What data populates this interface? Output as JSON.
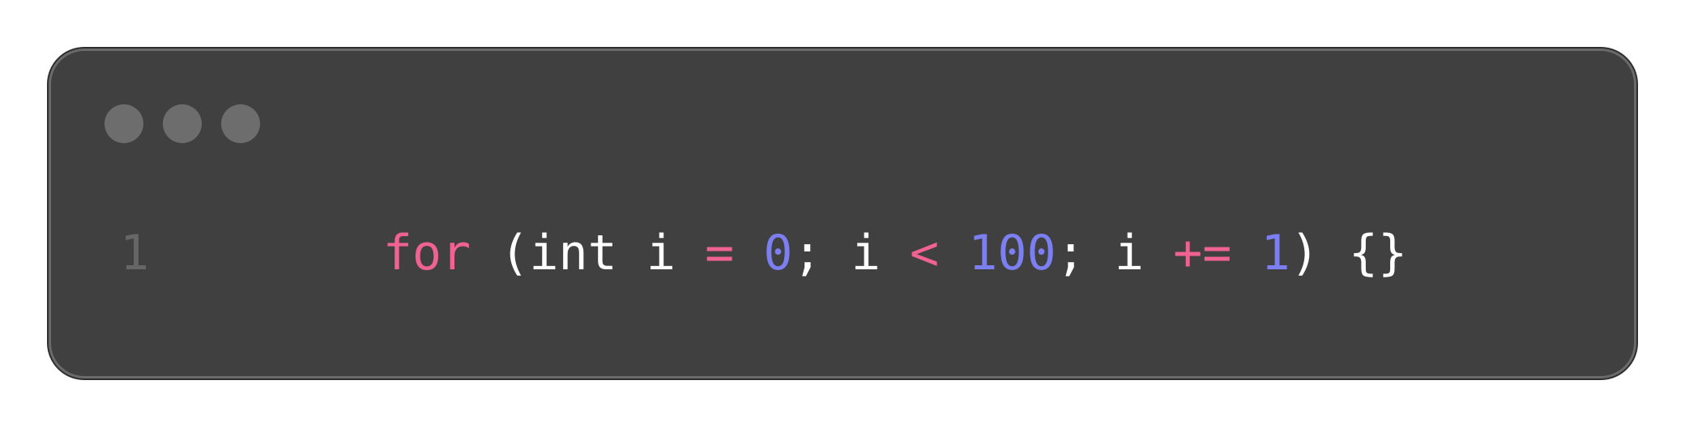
{
  "theme": {
    "background": "#404040",
    "border": "#6a6a6a",
    "window_dots": "#6d6d6d",
    "line_number": "#666666",
    "keyword": "#f06292",
    "operator": "#f06292",
    "number": "#7c7ff2",
    "plain": "#ffffff"
  },
  "window": {
    "controls": [
      "close-dot",
      "minimize-dot",
      "maximize-dot"
    ]
  },
  "code": {
    "lines": [
      {
        "number": "1",
        "tokens": [
          {
            "text": "for",
            "type": "keyword"
          },
          {
            "text": " (int i ",
            "type": "plain"
          },
          {
            "text": "=",
            "type": "operator"
          },
          {
            "text": " ",
            "type": "plain"
          },
          {
            "text": "0",
            "type": "number"
          },
          {
            "text": "; i ",
            "type": "plain"
          },
          {
            "text": "<",
            "type": "operator"
          },
          {
            "text": " ",
            "type": "plain"
          },
          {
            "text": "100",
            "type": "number"
          },
          {
            "text": "; i ",
            "type": "plain"
          },
          {
            "text": "+=",
            "type": "operator"
          },
          {
            "text": " ",
            "type": "plain"
          },
          {
            "text": "1",
            "type": "number"
          },
          {
            "text": ") {}",
            "type": "plain"
          }
        ]
      }
    ]
  }
}
